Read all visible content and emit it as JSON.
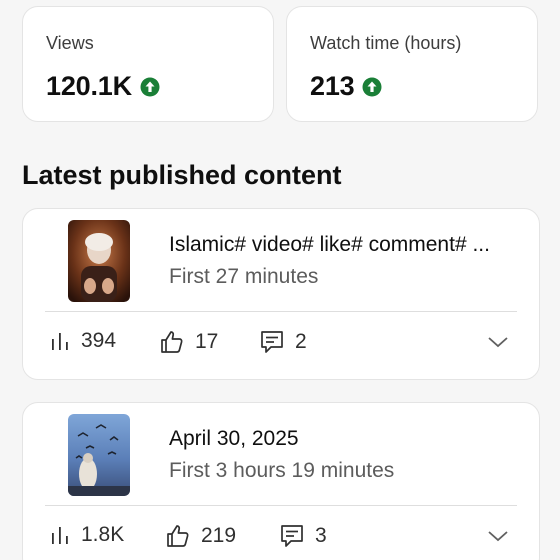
{
  "stats": [
    {
      "label": "Views",
      "value": "120.1K",
      "trend": "up"
    },
    {
      "label": "Watch time (hours)",
      "value": "213",
      "trend": "up"
    }
  ],
  "section_title": "Latest published content",
  "content": [
    {
      "title": "Islamic# video# like# comment# ...",
      "subtitle": "First 27 minutes",
      "views": "394",
      "likes": "17",
      "comments": "2"
    },
    {
      "title": "April 30, 2025",
      "subtitle": "First 3 hours 19 minutes",
      "views": "1.8K",
      "likes": "219",
      "comments": "3"
    }
  ],
  "icons": {
    "trend_up": "arrow-up-circle-icon",
    "views": "bar-chart-icon",
    "likes": "thumbs-up-icon",
    "comments": "comment-icon",
    "expand": "chevron-down-icon"
  },
  "colors": {
    "trend_up": "#1a7f37",
    "background": "#f6f6f6",
    "card": "#ffffff"
  }
}
